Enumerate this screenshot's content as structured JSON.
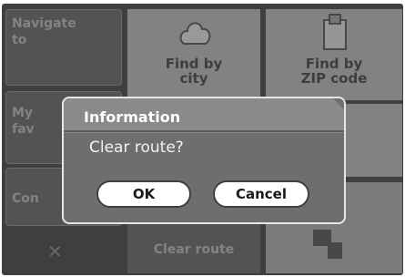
{
  "menu": {
    "navigate_to": [
      "Navigate",
      "to"
    ],
    "my_favorites": [
      "My",
      "fav"
    ],
    "contacts": "Con",
    "close_glyph": "✕"
  },
  "grid": {
    "find_city": [
      "Find by",
      "city"
    ],
    "find_zip": [
      "Find by",
      "ZIP code"
    ],
    "clear_route": "Clear route"
  },
  "dialog": {
    "title": "Information",
    "message": "Clear route?",
    "ok": "OK",
    "cancel": "Cancel"
  }
}
